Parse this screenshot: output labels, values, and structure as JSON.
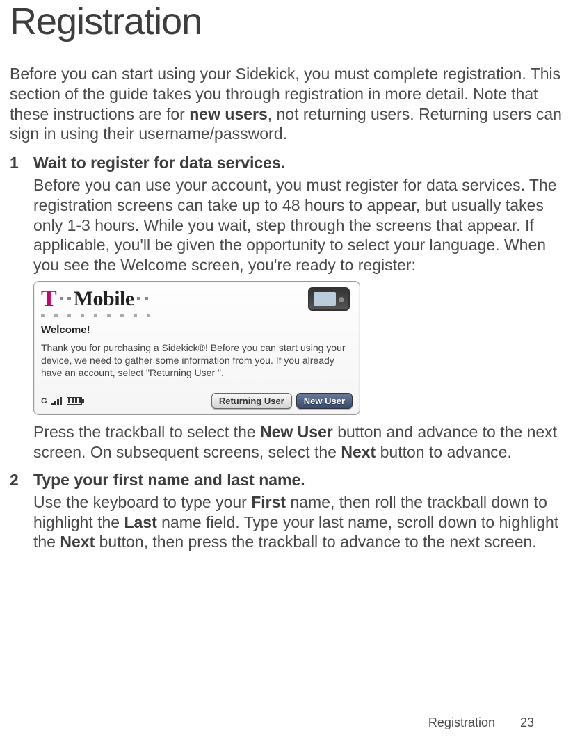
{
  "title": "Registration",
  "intro_parts": {
    "before": "Before you can start using your Sidekick, you must complete registration. This section of the guide takes you through registration in more detail. Note that these instructions are for ",
    "bold": "new users",
    "after": ", not returning users. Returning users can sign in using their username/password."
  },
  "steps": [
    {
      "num": "1",
      "title": "Wait to register for data services.",
      "body": "Before you can use your account, you must register for data services. The registration screens can take up to 48 hours to appear, but usually takes only 1-3 hours. While you wait, step through the screens that appear. If applicable, you'll be given the opportunity to select your language. When you see the Welcome screen, you're ready to register:",
      "after_parts": [
        "Press the trackball to select the ",
        "New User",
        " button and advance to the next screen. On subsequent screens, select the ",
        "Next",
        " button to advance."
      ]
    },
    {
      "num": "2",
      "title": "Type your first name and last name.",
      "body_parts": [
        "Use the keyboard to type your ",
        "First",
        " name, then roll the trackball down to highlight the ",
        "Last",
        " name field. Type your last name, scroll down to highlight the ",
        "Next",
        " button, then press the trackball to advance to the next screen."
      ]
    }
  ],
  "device": {
    "logo_t": "T",
    "logo_word": "Mobile",
    "welcome_label": "Welcome!",
    "welcome_text": "Thank you for purchasing a Sidekick®! Before you can start using your device, we need to gather some information from you. If you already have an account, select \"Returning User \".",
    "btn_returning": "Returning User",
    "btn_new": "New User"
  },
  "footer": {
    "section": "Registration",
    "page": "23"
  }
}
